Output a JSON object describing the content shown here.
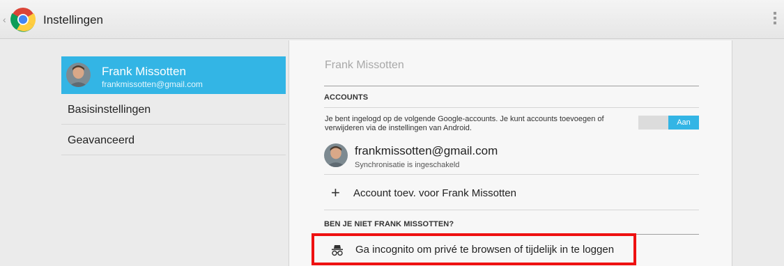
{
  "actionbar": {
    "title": "Instellingen",
    "up_caret": "‹"
  },
  "left_pane": {
    "account": {
      "name": "Frank Missotten",
      "email": "frankmissotten@gmail.com"
    },
    "nav_items": [
      {
        "label": "Basisinstellingen"
      },
      {
        "label": "Geavanceerd"
      }
    ]
  },
  "detail": {
    "profile_title": "Frank Missotten",
    "accounts_section": {
      "title": "ACCOUNTS",
      "description": "Je bent ingelogd op de volgende Google-accounts. Je kunt accounts toevoegen of verwijderen via de instellingen van Android.",
      "toggle_label": "Aan",
      "toggle_on": true
    },
    "account_entry": {
      "email": "frankmissotten@gmail.com",
      "status": "Synchronisatie is ingeschakeld"
    },
    "add_account": {
      "icon": "+",
      "label": "Account toev. voor Frank Missotten"
    },
    "not_you_section": {
      "title": "BEN JE NIET FRANK MISSOTTEN?"
    },
    "incognito": {
      "label": "Ga incognito om privé te browsen of tijdelijk in te loggen"
    }
  },
  "colors": {
    "accent": "#33b5e5",
    "highlight_box": "#ee1111"
  },
  "icons": {
    "app": "chrome-logo-icon",
    "overflow": "overflow-menu-icon",
    "incognito": "incognito-icon",
    "add": "plus-icon"
  }
}
